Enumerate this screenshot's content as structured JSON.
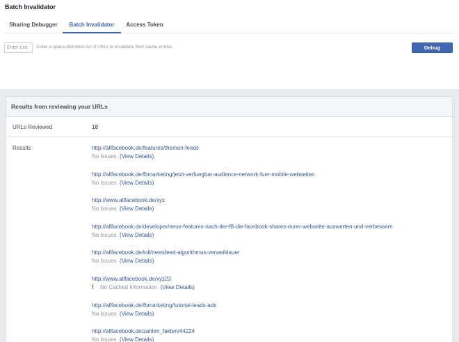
{
  "page": {
    "title": "Batch Invalidator"
  },
  "tabs": [
    {
      "label": "Sharing Debugger",
      "active": false
    },
    {
      "label": "Batch Invalidator",
      "active": true
    },
    {
      "label": "Access Token",
      "active": false
    }
  ],
  "input": {
    "placeholder": "Enter List",
    "value": "",
    "hint": "Enter a space-delimited list of URLs to invalidate their cache entries."
  },
  "toolbar": {
    "debug_label": "Debug"
  },
  "colors": {
    "accent": "#4267b2",
    "link": "#385898",
    "muted": "#90949c",
    "warning": "#d62c1a",
    "backdrop": "#e9ebee"
  },
  "results_panel": {
    "header": "Results from reviewing your URLs",
    "reviewed_label": "URLs Reviewed",
    "reviewed_count": "18",
    "results_label": "Results",
    "view_details_label": "View Details",
    "items": [
      {
        "url": "http://allfacebook.de/features/themen-feeds",
        "status": "No Issues",
        "warning": false
      },
      {
        "url": "http://allfacebook.de/fbmarketing/jetzt-verfuegbar-audience-network-fuer-mobile-webseiten",
        "status": "No Issues",
        "warning": false
      },
      {
        "url": "http://www.allfacebook.de/xyz",
        "status": "No Issues",
        "warning": false
      },
      {
        "url": "http://allfacebook.de/developer/neue-features-nach-der-f8-die-facebook-shares-eurer-webseite-auswerten-und-verbessern",
        "status": "No Issues",
        "warning": false
      },
      {
        "url": "http://allfacebook.de/toll/newsfeed-algorithmus-verweildauer",
        "status": "No Issues",
        "warning": false
      },
      {
        "url": "http://www.allfacebook.de/xyz23",
        "status": "No Cached Information",
        "warning": true,
        "icon": "exclamation-icon"
      },
      {
        "url": "http://allfacebook.de/fbmarketing/tutorial-leads-ads",
        "status": "No Issues",
        "warning": false
      },
      {
        "url": "http://allfacebook.de/zahlen_fakten/44224",
        "status": "No Issues",
        "warning": false
      }
    ]
  }
}
